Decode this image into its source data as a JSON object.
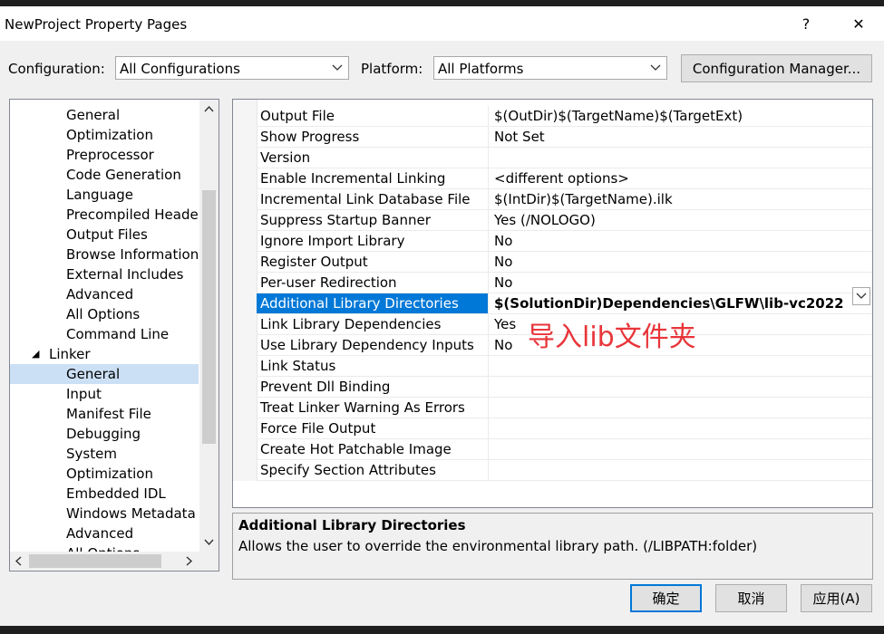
{
  "window": {
    "title": "NewProject Property Pages",
    "help_glyph": "?",
    "close_glyph": "✕"
  },
  "toolbar": {
    "configuration_label": "Configuration:",
    "configuration_value": "All Configurations",
    "platform_label": "Platform:",
    "platform_value": "All Platforms",
    "config_manager_label": "Configuration Manager..."
  },
  "tree": {
    "items": [
      {
        "label": "General",
        "indent": 2
      },
      {
        "label": "Optimization",
        "indent": 2
      },
      {
        "label": "Preprocessor",
        "indent": 2
      },
      {
        "label": "Code Generation",
        "indent": 2
      },
      {
        "label": "Language",
        "indent": 2
      },
      {
        "label": "Precompiled Heade",
        "indent": 2
      },
      {
        "label": "Output Files",
        "indent": 2
      },
      {
        "label": "Browse Information",
        "indent": 2
      },
      {
        "label": "External Includes",
        "indent": 2
      },
      {
        "label": "Advanced",
        "indent": 2
      },
      {
        "label": "All Options",
        "indent": 2
      },
      {
        "label": "Command Line",
        "indent": 2
      },
      {
        "label": "Linker",
        "indent": 1,
        "expanded": true
      },
      {
        "label": "General",
        "indent": 2,
        "selected": true
      },
      {
        "label": "Input",
        "indent": 2
      },
      {
        "label": "Manifest File",
        "indent": 2
      },
      {
        "label": "Debugging",
        "indent": 2
      },
      {
        "label": "System",
        "indent": 2
      },
      {
        "label": "Optimization",
        "indent": 2
      },
      {
        "label": "Embedded IDL",
        "indent": 2
      },
      {
        "label": "Windows Metadata",
        "indent": 2
      },
      {
        "label": "Advanced",
        "indent": 2
      },
      {
        "label": "All Options",
        "indent": 2
      }
    ]
  },
  "properties": [
    {
      "name": "Output File",
      "value": "$(OutDir)$(TargetName)$(TargetExt)"
    },
    {
      "name": "Show Progress",
      "value": "Not Set"
    },
    {
      "name": "Version",
      "value": ""
    },
    {
      "name": "Enable Incremental Linking",
      "value": "<different options>"
    },
    {
      "name": "Incremental Link Database File",
      "value": "$(IntDir)$(TargetName).ilk"
    },
    {
      "name": "Suppress Startup Banner",
      "value": "Yes (/NOLOGO)"
    },
    {
      "name": "Ignore Import Library",
      "value": "No"
    },
    {
      "name": "Register Output",
      "value": "No"
    },
    {
      "name": "Per-user Redirection",
      "value": "No"
    },
    {
      "name": "Additional Library Directories",
      "value": "$(SolutionDir)Dependencies\\GLFW\\lib-vc2022",
      "selected": true
    },
    {
      "name": "Link Library Dependencies",
      "value": "Yes"
    },
    {
      "name": "Use Library Dependency Inputs",
      "value": "No"
    },
    {
      "name": "Link Status",
      "value": ""
    },
    {
      "name": "Prevent Dll Binding",
      "value": ""
    },
    {
      "name": "Treat Linker Warning As Errors",
      "value": ""
    },
    {
      "name": "Force File Output",
      "value": ""
    },
    {
      "name": "Create Hot Patchable Image",
      "value": ""
    },
    {
      "name": "Specify Section Attributes",
      "value": ""
    }
  ],
  "annotation": "导入lib文件夹",
  "description": {
    "title": "Additional Library Directories",
    "text": "Allows the user to override the environmental library path. (/LIBPATH:folder)"
  },
  "buttons": {
    "ok": "确定",
    "cancel": "取消",
    "apply": "应用(A)"
  },
  "colors": {
    "selection": "#0078d7",
    "tree_selection": "#cce0f5",
    "annotation": "#e8353a"
  }
}
